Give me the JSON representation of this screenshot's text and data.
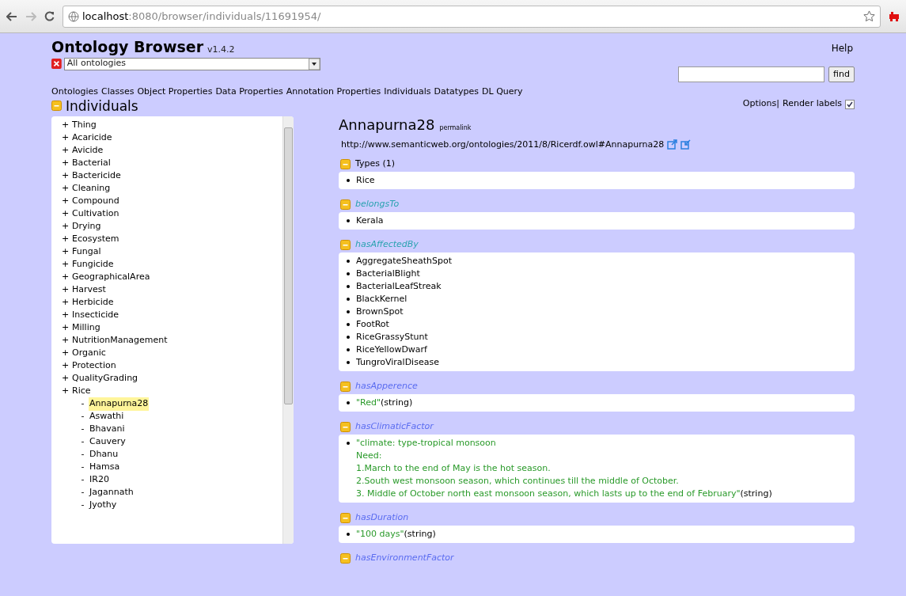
{
  "browser": {
    "url_host": "localhost",
    "url_rest": ":8080/browser/individuals/11691954/"
  },
  "header": {
    "title": "Ontology Browser",
    "version": "v1.4.2",
    "help": "Help",
    "ontology_select": "All ontologies",
    "find_button": "find",
    "options": "Options|",
    "render_labels": "Render labels",
    "render_labels_checked": true
  },
  "nav": [
    "Ontologies",
    "Classes",
    "Object Properties",
    "Data Properties",
    "Annotation Properties",
    "Individuals",
    "Datatypes",
    "DL Query"
  ],
  "sidebar": {
    "title": "Individuals",
    "items": [
      {
        "marker": "+",
        "label": "Thing",
        "selected": false
      },
      {
        "marker": "+",
        "label": "Acaricide",
        "selected": false
      },
      {
        "marker": "+",
        "label": "Avicide",
        "selected": false
      },
      {
        "marker": "+",
        "label": "Bacterial",
        "selected": false
      },
      {
        "marker": "+",
        "label": "Bactericide",
        "selected": false
      },
      {
        "marker": "+",
        "label": "Cleaning",
        "selected": false
      },
      {
        "marker": "+",
        "label": "Compound",
        "selected": false
      },
      {
        "marker": "+",
        "label": "Cultivation",
        "selected": false
      },
      {
        "marker": "+",
        "label": "Drying",
        "selected": false
      },
      {
        "marker": "+",
        "label": "Ecosystem",
        "selected": false
      },
      {
        "marker": "+",
        "label": "Fungal",
        "selected": false
      },
      {
        "marker": "+",
        "label": "Fungicide",
        "selected": false
      },
      {
        "marker": "+",
        "label": "GeographicalArea",
        "selected": false
      },
      {
        "marker": "+",
        "label": "Harvest",
        "selected": false
      },
      {
        "marker": "+",
        "label": "Herbicide",
        "selected": false
      },
      {
        "marker": "+",
        "label": "Insecticide",
        "selected": false
      },
      {
        "marker": "+",
        "label": "Milling",
        "selected": false
      },
      {
        "marker": "+",
        "label": "NutritionManagement",
        "selected": false
      },
      {
        "marker": "+",
        "label": "Organic",
        "selected": false
      },
      {
        "marker": "+",
        "label": "Protection",
        "selected": false
      },
      {
        "marker": "+",
        "label": "QualityGrading",
        "selected": false
      },
      {
        "marker": "+",
        "label": "Rice",
        "selected": false,
        "children": [
          {
            "marker": "-",
            "label": "Annapurna28",
            "selected": true
          },
          {
            "marker": "-",
            "label": "Aswathi",
            "selected": false
          },
          {
            "marker": "-",
            "label": "Bhavani",
            "selected": false
          },
          {
            "marker": "-",
            "label": "Cauvery",
            "selected": false
          },
          {
            "marker": "-",
            "label": "Dhanu",
            "selected": false
          },
          {
            "marker": "-",
            "label": "Hamsa",
            "selected": false
          },
          {
            "marker": "-",
            "label": "IR20",
            "selected": false
          },
          {
            "marker": "-",
            "label": "Jagannath",
            "selected": false
          },
          {
            "marker": "-",
            "label": "Jyothy",
            "selected": false
          }
        ]
      }
    ]
  },
  "individual": {
    "name": "Annapurna28",
    "permalink": "permalink",
    "iri": "http://www.semanticweb.org/ontologies/2011/8/Ricerdf.owl#Annapurna28"
  },
  "sections": [
    {
      "kind": "types",
      "title": "Types (1)",
      "values": [
        {
          "kind": "entity",
          "text": "Rice"
        }
      ]
    },
    {
      "kind": "object",
      "title": "belongsTo",
      "values": [
        {
          "kind": "entity",
          "text": "Kerala"
        }
      ]
    },
    {
      "kind": "object",
      "title": "hasAffectedBy",
      "values": [
        {
          "kind": "entity",
          "text": "AggregateSheathSpot"
        },
        {
          "kind": "entity",
          "text": "BacterialBlight"
        },
        {
          "kind": "entity",
          "text": "BacterialLeafStreak"
        },
        {
          "kind": "entity",
          "text": "BlackKernel"
        },
        {
          "kind": "entity",
          "text": "BrownSpot"
        },
        {
          "kind": "entity",
          "text": "FootRot"
        },
        {
          "kind": "entity",
          "text": "RiceGrassyStunt"
        },
        {
          "kind": "entity",
          "text": "RiceYellowDwarf"
        },
        {
          "kind": "entity",
          "text": "TungroViralDisease"
        }
      ]
    },
    {
      "kind": "data",
      "title": "hasApperence",
      "values": [
        {
          "kind": "literal",
          "lines": [
            "\"Red\""
          ],
          "datatype": "(string)"
        }
      ]
    },
    {
      "kind": "data",
      "title": "hasClimaticFactor",
      "values": [
        {
          "kind": "literal",
          "lines": [
            "\"climate: type-tropical monsoon",
            "Need:",
            "1.March to the end of May is the hot season.",
            "2.South west monsoon season, which continues till the middle of October.",
            "3. Middle of October north east monsoon season, which lasts up to the end of February\""
          ],
          "datatype": "(string)"
        }
      ]
    },
    {
      "kind": "data",
      "title": "hasDuration",
      "values": [
        {
          "kind": "literal",
          "lines": [
            "\"100 days\""
          ],
          "datatype": "(string)"
        }
      ]
    },
    {
      "kind": "data",
      "title": "hasEnvironmentFactor"
    }
  ]
}
